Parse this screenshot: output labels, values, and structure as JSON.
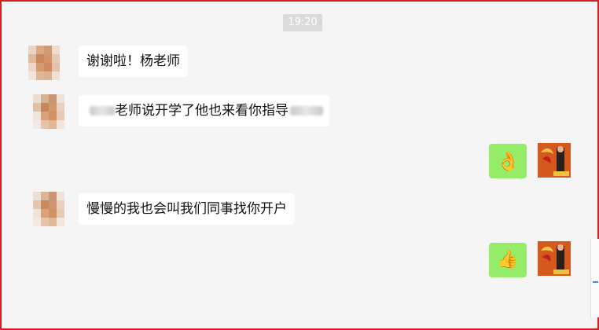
{
  "chat": {
    "timestamp": "19:20",
    "messages": [
      {
        "sender": "other",
        "text": "谢谢啦！杨老师"
      },
      {
        "sender": "other",
        "text": "…老师说开学了他也来看你指导…"
      },
      {
        "sender": "self",
        "emoji": "ok-hand-icon",
        "glyph": "👌"
      },
      {
        "sender": "other",
        "text": "慢慢的我也会叫我们同事找你开户"
      },
      {
        "sender": "self",
        "emoji": "thumbs-up-icon",
        "glyph": "👍"
      }
    ],
    "visible_fragment_msg2": "老师说开学了他也来看你指导"
  },
  "colors": {
    "frame_border": "#d61f1f",
    "self_bubble": "#95ec69",
    "other_bubble": "#ffffff",
    "chat_bg": "#f5f5f5"
  }
}
